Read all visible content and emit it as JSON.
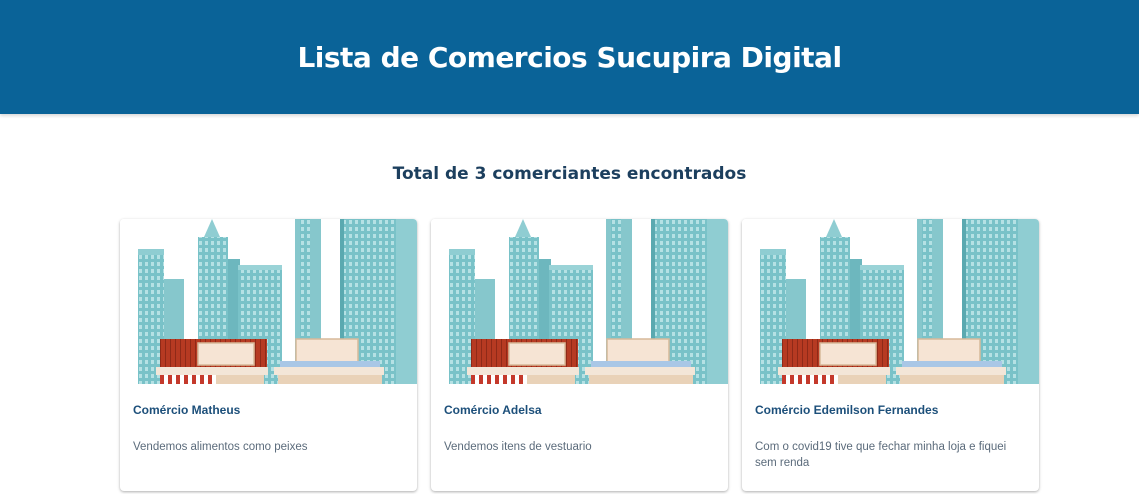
{
  "header": {
    "title": "Lista de Comercios Sucupira Digital"
  },
  "summary": {
    "total_text": "Total de 3 comerciantes encontrados"
  },
  "colors": {
    "header_bg": "#0a6398",
    "accent_text": "#1c4f7a"
  },
  "cards": [
    {
      "title": "Comércio Matheus",
      "description": "Vendemos alimentos como peixes",
      "image": "city-storefront-illustration"
    },
    {
      "title": "Comércio Adelsa",
      "description": "Vendemos itens de vestuario",
      "image": "city-storefront-illustration"
    },
    {
      "title": "Comércio Edemilson Fernandes",
      "description": "Com o covid19 tive que fechar minha loja e fiquei sem renda",
      "image": "city-storefront-illustration"
    }
  ]
}
